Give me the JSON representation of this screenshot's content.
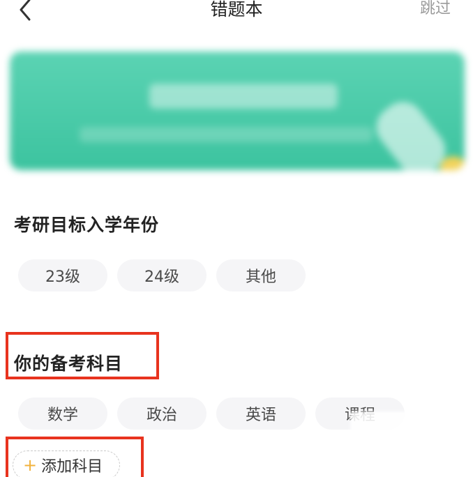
{
  "header": {
    "title": "错题本",
    "skip_label": "跳过",
    "back_icon": "chevron-left-icon"
  },
  "sections": {
    "year": {
      "title": "考研目标入学年份",
      "options": [
        "23级",
        "24级",
        "其他"
      ]
    },
    "subject": {
      "title": "你的备考科目",
      "options": [
        "数学",
        "政治",
        "英语",
        "课程"
      ],
      "add_label": "添加科目",
      "add_icon": "plus-icon"
    }
  },
  "colors": {
    "banner": "#4ccaa8",
    "highlight": "#e8331e",
    "accent_plus": "#f2b23c",
    "chip_bg": "#f5f5f7"
  }
}
